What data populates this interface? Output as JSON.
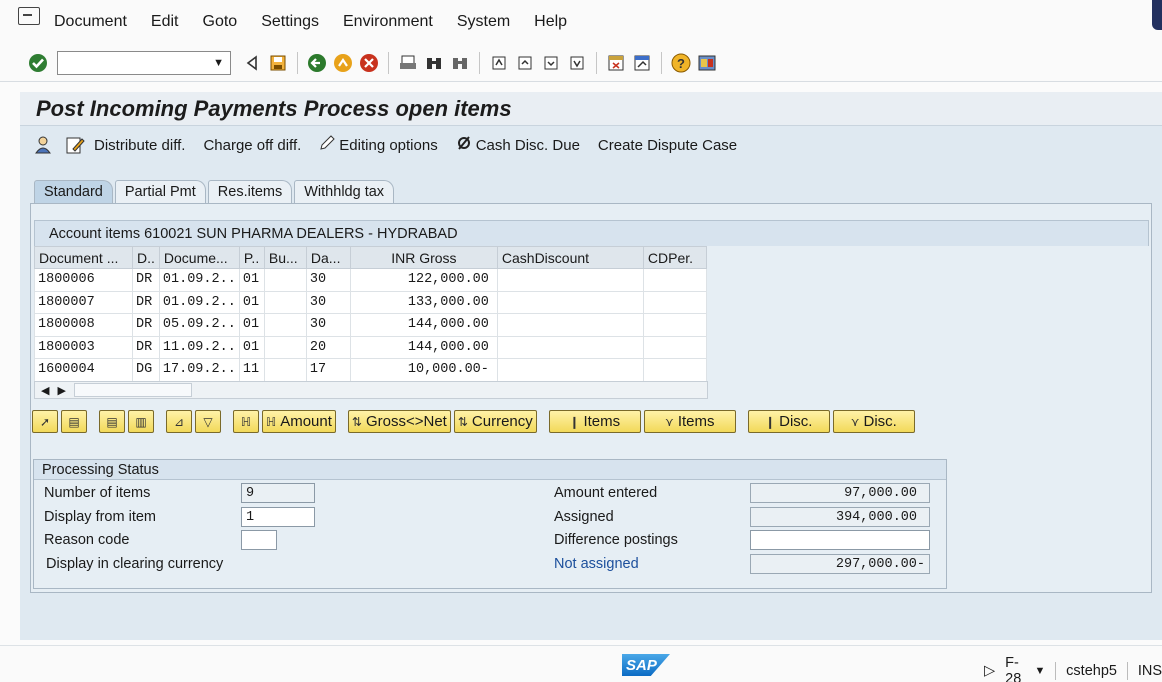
{
  "menubar": {
    "items": [
      "Document",
      "Edit",
      "Goto",
      "Settings",
      "Environment",
      "System",
      "Help"
    ]
  },
  "stdbar": {
    "command_value": ""
  },
  "page": {
    "title": "Post Incoming Payments Process open items"
  },
  "app_toolbar": {
    "distribute_diff": "Distribute diff.",
    "charge_off_diff": "Charge off diff.",
    "editing_options": "Editing options",
    "cash_disc_due": "Cash Disc. Due",
    "create_dispute_case": "Create Dispute Case"
  },
  "tabs": [
    "Standard",
    "Partial Pmt",
    "Res.items",
    "Withhldg tax"
  ],
  "account": {
    "title": "Account items 610021 SUN PHARMA DEALERS - HYDRABAD",
    "columns": [
      "Document ...",
      "D..",
      "Docume...",
      "P..",
      "Bu...",
      "Da...",
      "INR Gross",
      "CashDiscount",
      "CDPer."
    ],
    "rows": [
      [
        "1800006",
        "DR",
        "01.09.2..",
        "01",
        "",
        "30",
        "122,000.00",
        "",
        ""
      ],
      [
        "1800007",
        "DR",
        "01.09.2..",
        "01",
        "",
        "30",
        "133,000.00",
        "",
        ""
      ],
      [
        "1800008",
        "DR",
        "05.09.2..",
        "01",
        "",
        "30",
        "144,000.00",
        "",
        ""
      ],
      [
        "1800003",
        "DR",
        "11.09.2..",
        "01",
        "",
        "20",
        "144,000.00",
        "",
        ""
      ],
      [
        "1600004",
        "DG",
        "17.09.2..",
        "11",
        "",
        "17",
        "10,000.00-",
        "",
        ""
      ]
    ]
  },
  "grid_toolbar": {
    "amount": "Amount",
    "gross_net": "Gross<>Net",
    "currency": "Currency",
    "items_1": "Items",
    "items_2": "Items",
    "disc_1": "Disc.",
    "disc_2": "Disc."
  },
  "processing": {
    "title": "Processing Status",
    "number_of_items_label": "Number of items",
    "number_of_items": "9",
    "display_from_item_label": "Display from item",
    "display_from_item": "1",
    "reason_code_label": "Reason code",
    "reason_code": "",
    "display_clearing_label": "Display in clearing currency",
    "amount_entered_label": "Amount entered",
    "amount_entered": "97,000.00",
    "assigned_label": "Assigned",
    "assigned": "394,000.00",
    "difference_postings_label": "Difference postings",
    "difference_postings": "",
    "not_assigned_label": "Not assigned",
    "not_assigned": "297,000.00-"
  },
  "statusbar": {
    "logo": "SAP",
    "transaction": "F-28",
    "server": "cstehp5",
    "mode": "INS"
  }
}
